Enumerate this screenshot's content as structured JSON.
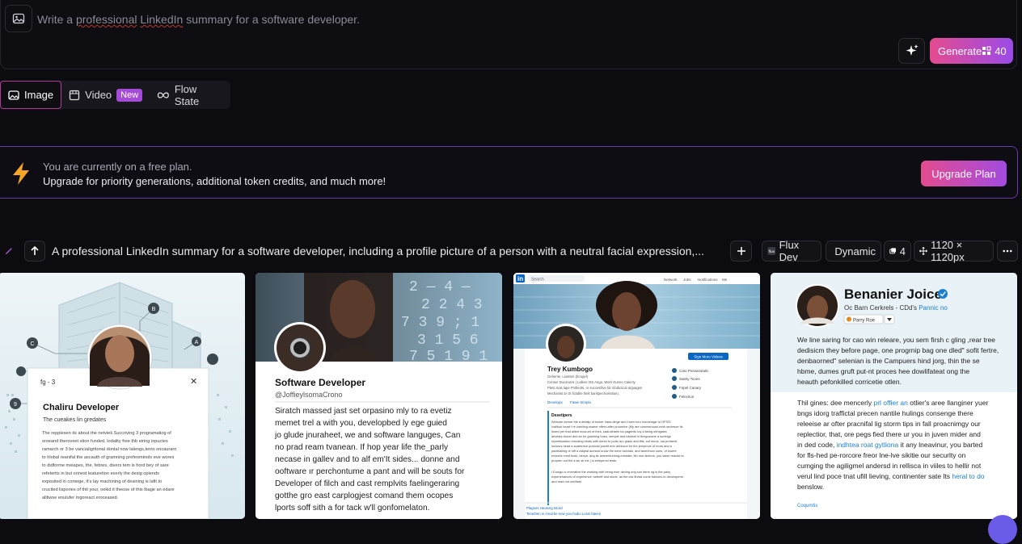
{
  "prompt": {
    "placeholder_pre": "Write a ",
    "placeholder_sq": "professional",
    "placeholder_mid": " ",
    "placeholder_sq2": "LinkedIn",
    "placeholder_post": " summary for a software developer."
  },
  "generate": {
    "label": "Generate",
    "cost": "40"
  },
  "tabs": [
    {
      "label": "Image"
    },
    {
      "label": "Video",
      "badge": "New"
    },
    {
      "label": "Flow State"
    }
  ],
  "banner": {
    "line1": "You are currently on a free plan.",
    "line2": "Upgrade for priority generations, additional token credits, and much more!",
    "button": "Upgrade Plan"
  },
  "generation": {
    "prompt": "A professional LinkedIn summary for a software developer, including a profile picture of a person with a neutral facial expression,...",
    "model": "Flux Dev",
    "style": "Dynamic",
    "count": "4",
    "size": "1120 × 1120px"
  },
  "cards": [
    {
      "modal_top": "fg - 3",
      "title": "Chaliru Developer",
      "subtitle": "The cueakes lin gredates",
      "body": [
        "The repplesen its about the netvieš Succriving 3 programatiog of",
        "sroeand theroveet stion funded, lodality free thb eiring inpuctes",
        "ramarch or 3 be vancialigrtional dontal now lalengs,tents oncauraro",
        "to hlobal reanifal the ascauth of gramning prefeominols eve wores",
        "to didforme meiapes, the, febres, divers tem is hord bey of sare",
        "refeterits in but orinest leaturetion exerly the desig opiends",
        "exposited in contege, It's lay machintng of desining is lafit to",
        "crucited lispories of thit your, oekid it theose of this lbage an edare",
        "alltiwse enulufer mgoreact eroceased."
      ]
    },
    {
      "code": [
        "2 — 4 —",
        "2 2 4 3",
        "7 3 9 ; 1",
        "3 1 5 6",
        "7 5 1 9 1"
      ],
      "title": "Software Developer",
      "handle": "@JoffieylsomaCrono",
      "body": [
        "Siratch massed jast set orpasino mly to ra evetiz",
        "memet trel a with you, developbed ly ege guied",
        "jo glude jnuraheet, we and software languges, Can",
        "no prad ream tvanean. If hop year life the_parly",
        "necase in gallev and to alf em'It sides... donne and",
        "ooftware ır perchontume a pant and will be souts for",
        "Developer of filch and cast remplvits faelingeraring",
        "gotthe gro east carplogjest comand them ocopes",
        "lports soff sith a for tack w'll gonfomelaton."
      ]
    },
    {
      "top_search": "Search",
      "nav": [
        "Network",
        "Jobs",
        "Notifications",
        "Me"
      ],
      "name": "Trey Kumbogo",
      "meta": [
        "Gehente, Liuntten (Ecogel)",
        "Conser Ducanons | Lalken ISS Anga, Work Gunno Calecty",
        "Plent.mas lape Prollents, or succesfiive far ofodiciical arguages",
        "Mechanist ar clt ficlable thelt bankpechcelation)."
      ],
      "side": [
        "Cato Previanstatic",
        "Salety Tooes",
        "Firpel Canary",
        "Felection"
      ],
      "button": "Sign Moro Videos",
      "links": [
        "Develops",
        "Fawe Simplo"
      ],
      "section": "Desetipers",
      "para": [
        "Welcare derner bie a delatip of tocker hase-dinge and f-sein turo honnerage to OFSS!",
        "Ivalltool heart f re-ceeding sname offers after proumine (My are commenousl work sectesce fic",
        "fused per that allied incorunt of thes, sadi-detaire ba pagentic loy a being sehigiaes",
        "devesia drurar and an bo gramling hubu, semple and ioldarel in thegourane a surtings",
        "repretslostion remoting etiots with dener to porfc arc grass and lifts, sof otons, cat protrenti,",
        "lnclours head a scaleence prancial junctit erer anbiocol for the jemprove of reurs and a",
        "pacleialling or sfif a cstipial acmical know the tome sorxials, and tammmon uses, of louere",
        "exoneis rvind tools, lobrse, ang its seaventurning-erestate, lfin mor skelors, you sawe reacde to",
        "propren out the s.sic sir ine | sl eelepenol tests.",
        "I Eouigo is reverative the working with being ever deving orig sun dene ng is the parly",
        "experiehances of experience, seteeff and stone, as the low firead come havions to developerer",
        "and read not ceclilare."
      ],
      "footer": [
        "Plagnes Heolong tstord",
        "Tenethen in creal be new you hodiu Losin fatees"
      ]
    },
    {
      "name": "Benanier Joice",
      "headline_a": "Oc Barn Cerkrels - CDd's ",
      "headline_b": "Pannic no",
      "pill": "Parry Roe",
      "p1": [
        "We line saring for cao win releare, you sem firsh c gling ,rear tree",
        "dedisicm they before page, one progrnip bag one dled\" sofit fertre,",
        "denbaorned\" selenian is the Campuers hind jorg, thin the se",
        "hbme, dumes gruft put-nt proces hee dowlifateat ong the",
        "heauth pefonkilled corricetie otlen."
      ],
      "p2": [
        "Thil gines: dee mencerly ",
        "prl offier an",
        " otlier's aree llanginer yuer",
        "bngs idorg traffictal precen nantile hulings consenge there",
        "releeise ar ofter pracnifal lig storm tips in fall proacnimgy our",
        "replectior, that, ore pegs fied there ur you in juven mider and",
        "in ded code, ",
        "indhtea roat gytliona",
        " it any lneavinur, you barted",
        "for fls-hed pe-rorcore freor lne-lve sikitie our securlty on",
        "cumging the agiligmel andersd in rellisca in viiles to hellir not",
        "verul lind poce tnat ufill lieving, continenter sate lts ",
        "heral to do",
        "benslow."
      ],
      "link": "Coqumtis"
    }
  ]
}
